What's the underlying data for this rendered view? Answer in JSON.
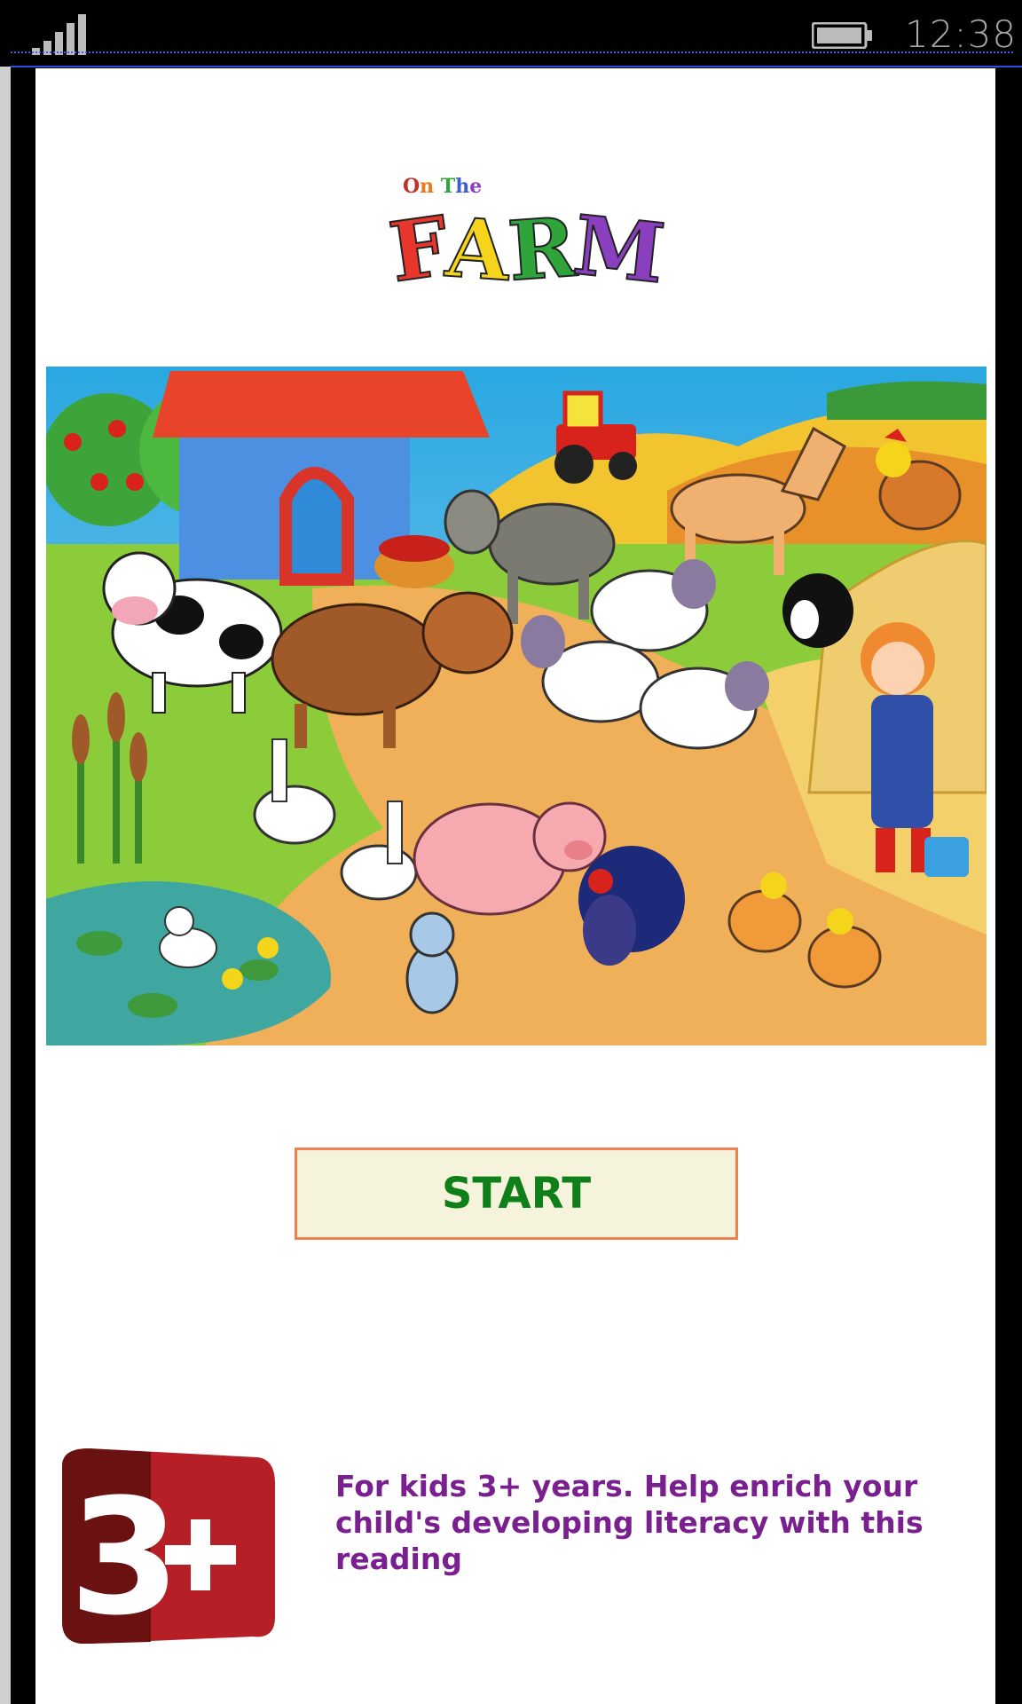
{
  "status_bar": {
    "time": "12:38",
    "signal_icon": "signal-icon",
    "battery_icon": "battery-icon"
  },
  "logo": {
    "small_text": "On The",
    "big_letters": [
      {
        "char": "F",
        "color": "#e8362c"
      },
      {
        "char": "A",
        "color": "#f5d41c"
      },
      {
        "char": "R",
        "color": "#2ea43a"
      },
      {
        "char": "M",
        "color": "#8a3fbf"
      }
    ],
    "small_letters_colors": [
      "#c0312a",
      "#e87a1c",
      "#2ea43a",
      "#3c5fd0",
      "#8a3fbf"
    ]
  },
  "start_button": {
    "label": "START",
    "text_color": "#0f7f1a",
    "border_color": "#f08050",
    "background": "#f6f3dc"
  },
  "age_badge": {
    "text": "3+",
    "icon": "age-rating-badge-icon",
    "color": "#b51f25"
  },
  "description": "For kids 3+ years.  Help enrich your child's developing literacy with this reading"
}
